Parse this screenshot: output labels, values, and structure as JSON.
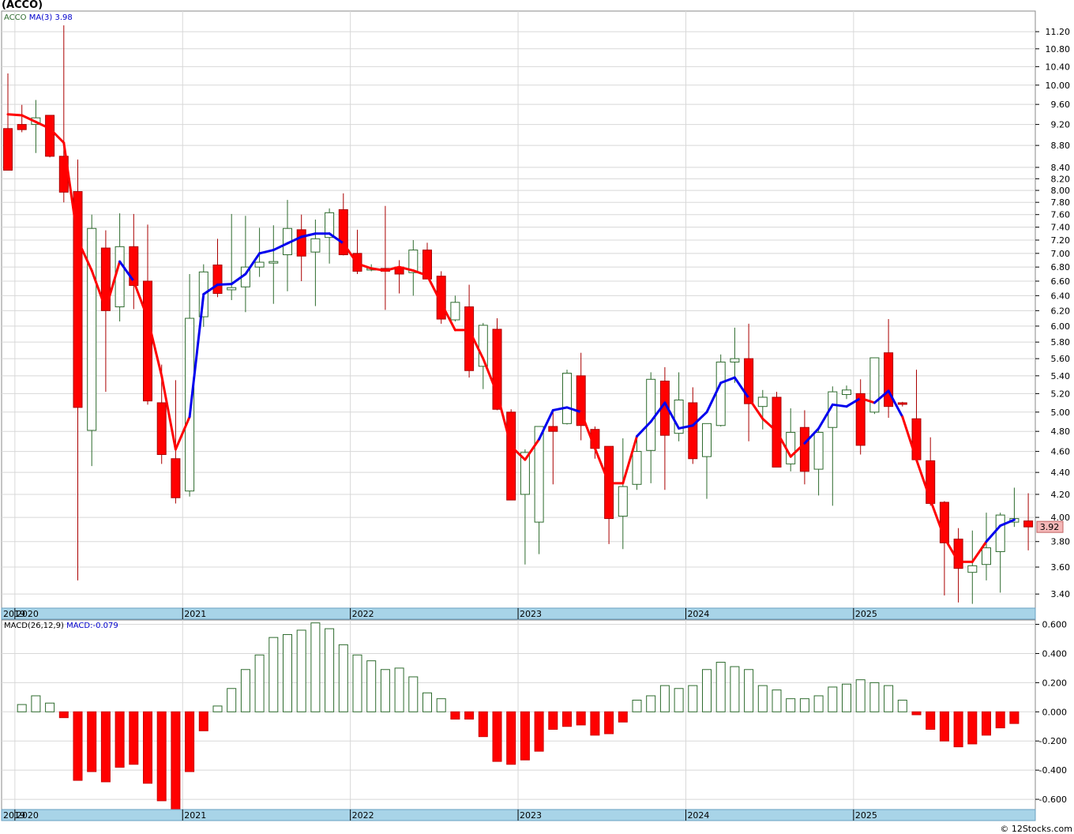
{
  "title": "(ACCO)",
  "credit": "© 12Stocks.com",
  "colors": {
    "up_candle": "#2e6b2e",
    "down_candle": "#ff0000",
    "ma_up": "#0000ee",
    "ma_down": "#ff0000",
    "macd_pos": "#2e6b2e",
    "macd_neg": "#ff0000",
    "axis_band": "#a8d4e8",
    "grid": "#d8d8d8",
    "price_tag_bg": "#f4b8b8"
  },
  "year_labels": [
    "2019",
    "2020",
    "2021",
    "2022",
    "2023",
    "2024",
    "2025"
  ],
  "chart_data": [
    {
      "type": "candlestick",
      "legend": {
        "symbol": "ACCO",
        "ma_label": "MA(3)",
        "ma_value": "3.98"
      },
      "last_price_label": "3.92",
      "y_scale": "log",
      "ylim": [
        3.3,
        11.7
      ],
      "yticks": [
        "3.40",
        "3.60",
        "3.80",
        "4.00",
        "4.20",
        "4.40",
        "4.60",
        "4.80",
        "5.00",
        "5.20",
        "5.40",
        "5.60",
        "5.80",
        "6.00",
        "6.20",
        "6.40",
        "6.60",
        "6.80",
        "7.00",
        "7.20",
        "7.40",
        "7.60",
        "7.80",
        "8.00",
        "8.20",
        "8.40",
        "8.80",
        "9.20",
        "9.60",
        "10.00",
        "10.40",
        "10.80",
        "11.20"
      ],
      "months": [
        "2019-12",
        "2020-01",
        "2020-02",
        "2020-03",
        "2020-04",
        "2020-05",
        "2020-06",
        "2020-07",
        "2020-08",
        "2020-09",
        "2020-10",
        "2020-11",
        "2020-12",
        "2021-01",
        "2021-02",
        "2021-03",
        "2021-04",
        "2021-05",
        "2021-06",
        "2021-07",
        "2021-08",
        "2021-09",
        "2021-10",
        "2021-11",
        "2021-12",
        "2022-01",
        "2022-02",
        "2022-03",
        "2022-04",
        "2022-05",
        "2022-06",
        "2022-07",
        "2022-08",
        "2022-09",
        "2022-10",
        "2022-11",
        "2022-12",
        "2023-01",
        "2023-02",
        "2023-03",
        "2023-04",
        "2023-05",
        "2023-06",
        "2023-07",
        "2023-08",
        "2023-09",
        "2023-10",
        "2023-11",
        "2023-12",
        "2024-01",
        "2024-02",
        "2024-03",
        "2024-04",
        "2024-05",
        "2024-06",
        "2024-07",
        "2024-08",
        "2024-09",
        "2024-10",
        "2024-11",
        "2024-12",
        "2025-01",
        "2025-02",
        "2025-03",
        "2025-04",
        "2025-05",
        "2025-06",
        "2025-07",
        "2025-08",
        "2025-09"
      ],
      "candles": [
        [
          9.12,
          10.25,
          8.76,
          8.35
        ],
        [
          9.2,
          9.59,
          9.05,
          9.1
        ],
        [
          9.2,
          9.69,
          8.66,
          9.33
        ],
        [
          9.38,
          9.38,
          8.58,
          8.6
        ],
        [
          8.6,
          11.35,
          7.8,
          7.97
        ],
        [
          7.98,
          8.54,
          3.5,
          5.05
        ],
        [
          4.81,
          7.6,
          4.46,
          7.38
        ],
        [
          7.08,
          7.35,
          5.22,
          6.2
        ],
        [
          6.25,
          7.62,
          6.06,
          7.1
        ],
        [
          7.1,
          7.61,
          6.22,
          6.54
        ],
        [
          6.6,
          7.44,
          5.08,
          5.12
        ],
        [
          5.1,
          5.53,
          4.48,
          4.57
        ],
        [
          4.53,
          5.35,
          4.12,
          4.17
        ],
        [
          4.23,
          6.7,
          4.18,
          6.1
        ],
        [
          6.12,
          6.84,
          5.99,
          6.73
        ],
        [
          6.83,
          7.22,
          6.38,
          6.43
        ],
        [
          6.48,
          7.61,
          6.34,
          6.51
        ],
        [
          6.52,
          7.58,
          6.18,
          6.8
        ],
        [
          6.8,
          7.39,
          6.66,
          6.87
        ],
        [
          6.87,
          7.43,
          6.29,
          6.88
        ],
        [
          6.98,
          7.84,
          6.46,
          7.38
        ],
        [
          7.36,
          7.6,
          6.6,
          6.96
        ],
        [
          7.02,
          7.52,
          6.26,
          7.22
        ],
        [
          7.24,
          7.7,
          6.85,
          7.63
        ],
        [
          7.68,
          7.95,
          6.97,
          6.98
        ],
        [
          7.0,
          7.36,
          6.7,
          6.74
        ],
        [
          6.76,
          6.84,
          6.74,
          6.78
        ],
        [
          6.78,
          7.74,
          6.21,
          6.74
        ],
        [
          6.8,
          6.9,
          6.43,
          6.7
        ],
        [
          6.72,
          7.2,
          6.4,
          7.05
        ],
        [
          7.05,
          7.16,
          6.65,
          6.63
        ],
        [
          6.67,
          6.74,
          6.03,
          6.09
        ],
        [
          6.08,
          6.4,
          6.06,
          6.31
        ],
        [
          6.25,
          6.55,
          5.38,
          5.46
        ],
        [
          5.51,
          6.04,
          5.25,
          6.01
        ],
        [
          5.96,
          6.1,
          5.02,
          5.03
        ],
        [
          5.0,
          5.03,
          4.23,
          4.15
        ],
        [
          4.2,
          4.62,
          3.62,
          4.59
        ],
        [
          3.96,
          4.84,
          3.7,
          4.85
        ],
        [
          4.85,
          5.02,
          4.29,
          4.8
        ],
        [
          4.88,
          5.47,
          4.87,
          5.43
        ],
        [
          5.4,
          5.67,
          4.71,
          4.86
        ],
        [
          4.82,
          4.85,
          4.53,
          4.63
        ],
        [
          4.65,
          4.65,
          3.78,
          3.99
        ],
        [
          4.01,
          4.73,
          3.74,
          4.27
        ],
        [
          4.29,
          4.76,
          4.24,
          4.6
        ],
        [
          4.61,
          5.44,
          4.3,
          5.36
        ],
        [
          5.34,
          5.5,
          4.24,
          4.76
        ],
        [
          4.78,
          5.44,
          4.7,
          5.13
        ],
        [
          5.1,
          5.27,
          4.48,
          4.53
        ],
        [
          4.55,
          4.87,
          4.16,
          4.88
        ],
        [
          4.86,
          5.65,
          4.85,
          5.56
        ],
        [
          5.56,
          5.98,
          5.32,
          5.6
        ],
        [
          5.6,
          6.03,
          4.7,
          5.09
        ],
        [
          5.06,
          5.24,
          4.82,
          5.16
        ],
        [
          5.16,
          5.22,
          4.46,
          4.45
        ],
        [
          4.48,
          5.04,
          4.41,
          4.79
        ],
        [
          4.84,
          5.02,
          4.29,
          4.41
        ],
        [
          4.43,
          4.82,
          4.19,
          4.79
        ],
        [
          4.84,
          5.28,
          4.1,
          5.22
        ],
        [
          5.19,
          5.29,
          5.14,
          5.24
        ],
        [
          5.2,
          5.36,
          4.57,
          4.66
        ],
        [
          5.0,
          5.47,
          4.98,
          5.61
        ],
        [
          5.67,
          6.09,
          4.94,
          5.06
        ],
        [
          5.1,
          5.11,
          5.06,
          5.09
        ],
        [
          4.93,
          5.47,
          4.75,
          4.52
        ],
        [
          4.51,
          4.74,
          4.1,
          4.12
        ],
        [
          4.13,
          4.14,
          3.39,
          3.79
        ],
        [
          3.82,
          3.91,
          3.34,
          3.59
        ],
        [
          3.56,
          3.89,
          3.33,
          3.61
        ]
      ],
      "candles_tail": [
        [
          3.62,
          4.04,
          3.5,
          3.75
        ],
        [
          3.72,
          4.04,
          3.41,
          4.02
        ],
        [
          3.96,
          4.26,
          3.92,
          3.99
        ],
        [
          3.97,
          4.21,
          3.73,
          3.92
        ]
      ],
      "ma3": [
        9.4,
        9.38,
        9.25,
        9.12,
        8.85,
        7.2,
        6.75,
        6.22,
        6.88,
        6.6,
        6.1,
        5.4,
        4.62,
        4.95,
        6.42,
        6.55,
        6.56,
        6.7,
        7.0,
        7.05,
        7.15,
        7.25,
        7.3,
        7.3,
        7.15,
        6.85,
        6.78,
        6.75,
        6.8,
        6.75,
        6.68,
        6.3,
        5.95,
        5.95,
        5.6,
        5.2,
        4.65,
        4.52,
        4.72,
        5.02,
        5.05,
        5.0,
        4.63,
        4.3,
        4.3,
        4.75,
        4.9,
        5.1,
        4.83,
        4.86,
        5.0,
        5.32,
        5.38,
        5.15,
        4.93,
        4.8,
        4.55,
        4.68,
        4.83,
        5.08,
        5.06,
        5.15,
        5.1,
        5.23,
        4.95,
        4.52,
        4.15,
        3.83,
        3.64,
        3.64,
        3.8,
        3.93,
        3.98
      ],
      "ma3_colors": [
        "r",
        "r",
        "r",
        "r",
        "r",
        "r",
        "r",
        "r",
        "b",
        "r",
        "r",
        "r",
        "r",
        "b",
        "b",
        "b",
        "b",
        "b",
        "b",
        "b",
        "b",
        "b",
        "b",
        "b",
        "r",
        "r",
        "r",
        "r",
        "r",
        "r",
        "r",
        "r",
        "r",
        "r",
        "r",
        "r",
        "r",
        "r",
        "b",
        "b",
        "b",
        "r",
        "r",
        "r",
        "r",
        "b",
        "b",
        "b",
        "b",
        "b",
        "b",
        "b",
        "b",
        "r",
        "r",
        "r",
        "r",
        "b",
        "b",
        "b",
        "b",
        "r",
        "b",
        "b",
        "r",
        "r",
        "r",
        "r",
        "r",
        "r",
        "b",
        "b",
        "b"
      ]
    },
    {
      "type": "bar",
      "legend": {
        "label": "MACD(26,12,9)",
        "value_label": "MACD:-0.079"
      },
      "ylim": [
        -0.67,
        0.63
      ],
      "yticks": [
        "-0.600",
        "-0.400",
        "-0.200",
        "0.000",
        "0.200",
        "0.400",
        "0.600"
      ],
      "values": [
        0.05,
        0.11,
        0.06,
        -0.04,
        -0.47,
        -0.41,
        -0.48,
        -0.38,
        -0.36,
        -0.49,
        -0.61,
        -0.67,
        -0.41,
        -0.13,
        0.04,
        0.16,
        0.29,
        0.39,
        0.51,
        0.53,
        0.56,
        0.61,
        0.57,
        0.46,
        0.39,
        0.35,
        0.29,
        0.3,
        0.24,
        0.13,
        0.09,
        -0.05,
        -0.05,
        -0.17,
        -0.34,
        -0.36,
        -0.33,
        -0.27,
        -0.12,
        -0.1,
        -0.09,
        -0.16,
        -0.15,
        -0.07,
        0.08,
        0.11,
        0.18,
        0.16,
        0.18,
        0.29,
        0.34,
        0.31,
        0.29,
        0.18,
        0.15,
        0.09,
        0.09,
        0.11,
        0.17,
        0.19,
        0.22,
        0.2,
        0.18,
        0.08,
        -0.02,
        -0.12,
        -0.2,
        -0.24,
        -0.22,
        -0.16,
        -0.11,
        -0.08
      ]
    }
  ]
}
